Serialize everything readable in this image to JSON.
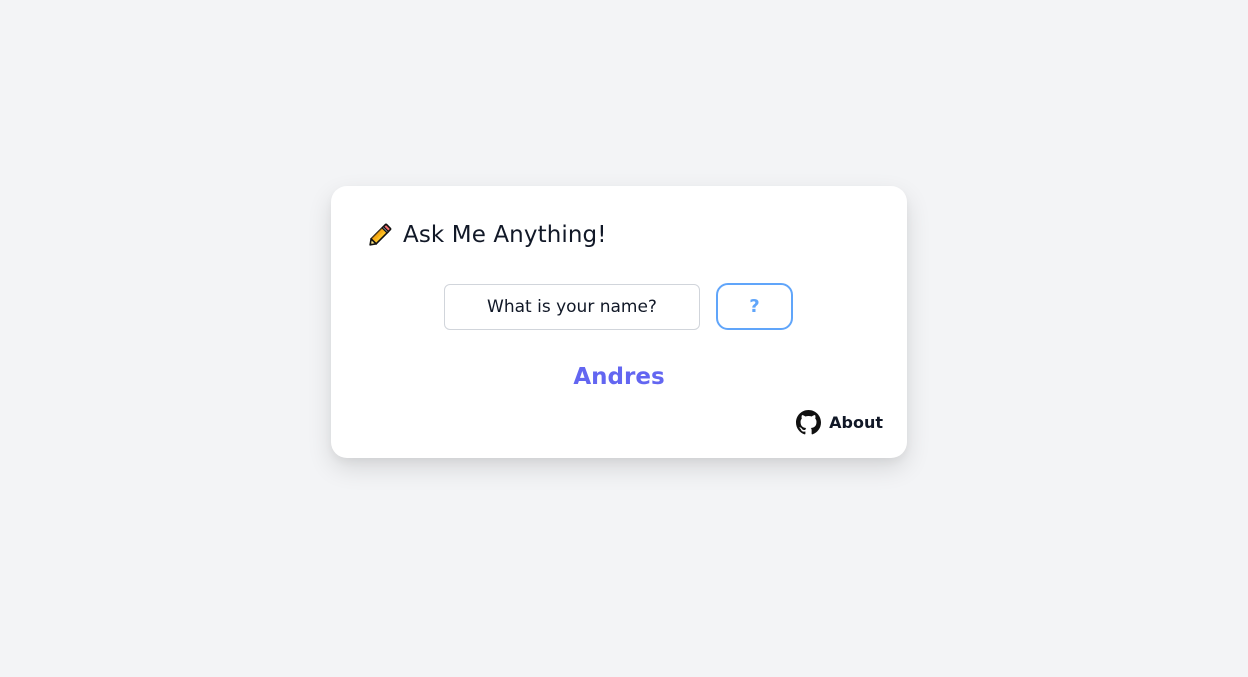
{
  "header": {
    "icon": "pencil-icon",
    "title": "Ask Me Anything!"
  },
  "ask": {
    "input_value": "What is your name?",
    "button_label": "?"
  },
  "answer": {
    "text": "Andres"
  },
  "footer": {
    "icon": "github-icon",
    "about_label": "About"
  },
  "colors": {
    "background": "#f3f4f6",
    "card": "#ffffff",
    "accent_button": "#60a5fa",
    "answer": "#6366f1",
    "text": "#111827"
  }
}
